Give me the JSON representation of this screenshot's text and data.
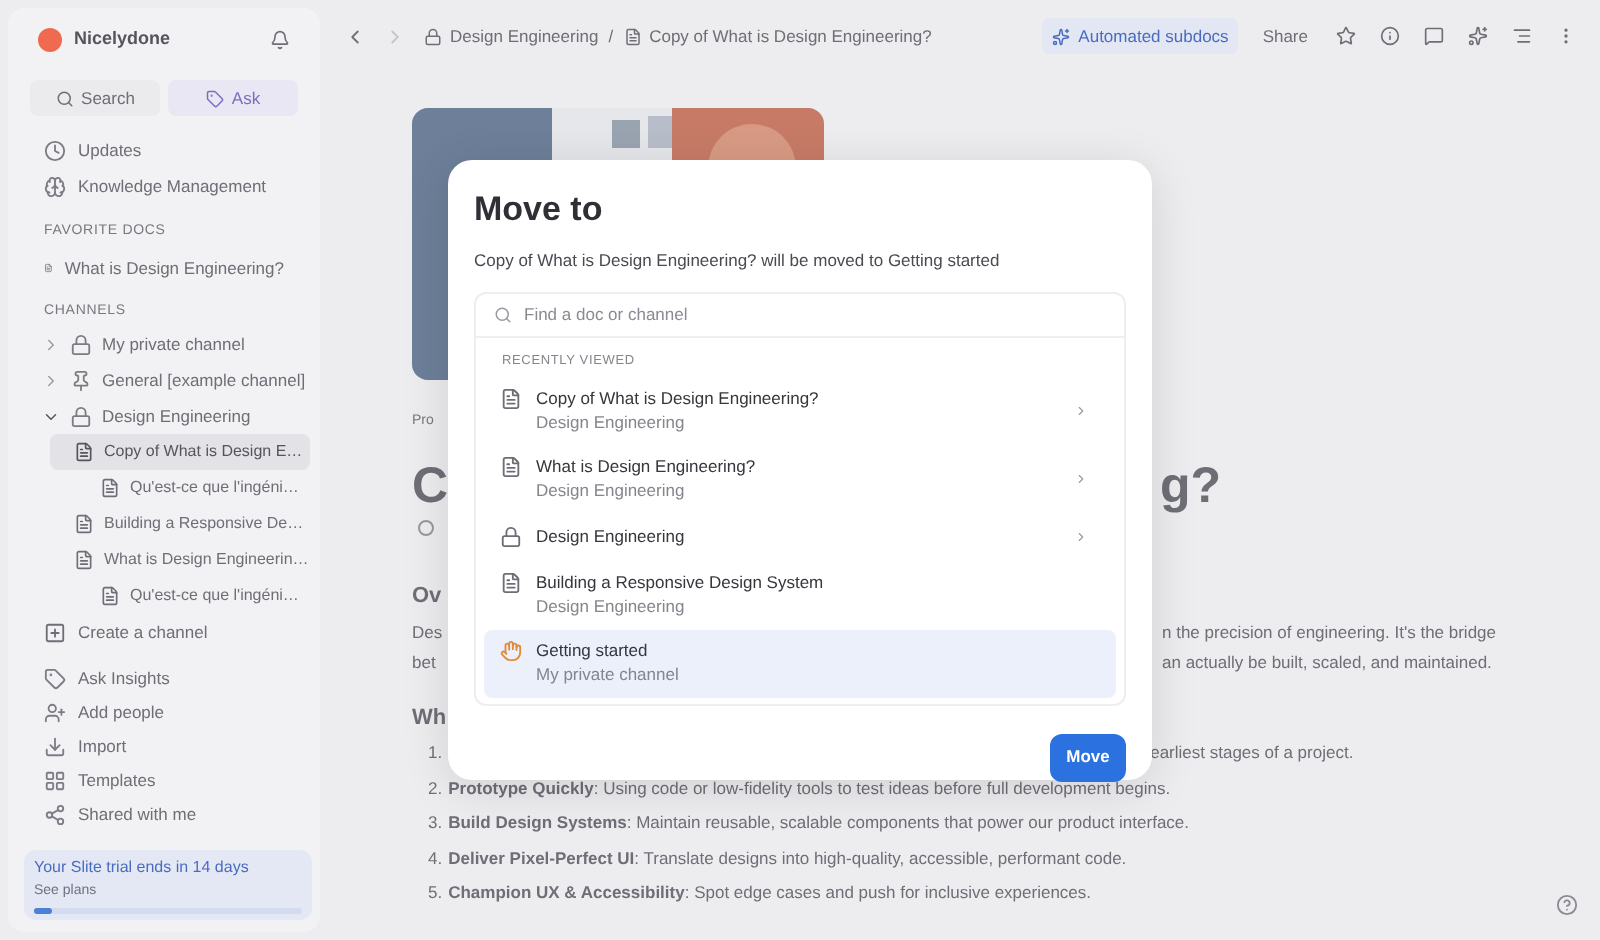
{
  "sidebar": {
    "workspace": "Nicelydone",
    "search": "Search",
    "ask": "Ask",
    "nav": [
      {
        "label": "Updates",
        "kind": "clock"
      },
      {
        "label": "Knowledge Management",
        "kind": "brain"
      }
    ],
    "favorites": {
      "heading": "FAVORITE DOCS",
      "items": [
        {
          "label": "What is Design Engineering?"
        }
      ]
    },
    "channels": {
      "heading": "CHANNELS",
      "items": [
        {
          "label": "My private channel",
          "kind": "lock",
          "expanded": false
        },
        {
          "label": "General [example channel]",
          "kind": "pin",
          "expanded": false
        },
        {
          "label": "Design Engineering",
          "kind": "lock",
          "expanded": true,
          "children": [
            {
              "label": "Copy of What is Design E…",
              "selected": true,
              "children": [
                {
                  "label": "Qu'est-ce que l'ingéni…",
                  "selected": false
                }
              ]
            },
            {
              "label": "Building a Responsive De…",
              "selected": false
            },
            {
              "label": "What is Design Engineerin…",
              "selected": false,
              "children": [
                {
                  "label": "Qu'est-ce que l'ingéni…",
                  "selected": false
                }
              ]
            }
          ]
        }
      ]
    },
    "create_channel": "Create a channel",
    "actions": [
      {
        "label": "Ask Insights",
        "kind": "sparkle"
      },
      {
        "label": "Add people",
        "kind": "person"
      },
      {
        "label": "Import",
        "kind": "import"
      },
      {
        "label": "Templates",
        "kind": "grid"
      },
      {
        "label": "Shared with me",
        "kind": "shared"
      }
    ],
    "trial": {
      "title": "Your Slite trial ends in 14 days",
      "link": "See plans",
      "level": 0.07
    }
  },
  "top_bar": {
    "breadcrumb": [
      {
        "label": "Design Engineering",
        "kind": "channel"
      },
      {
        "label": "Copy of What is Design Engineering?",
        "kind": "doc"
      }
    ],
    "separator": "/",
    "automated": "Automated subdocs",
    "share": "Share"
  },
  "document": {
    "label": "Pro",
    "title_start": "C",
    "title_end": "g?",
    "heading_1": "Ov",
    "paragraph": [
      {
        "left": "Des",
        "right": "n the precision of engineering. It's the bridge"
      },
      {
        "left": "bet",
        "right": "an actually be built, scaled, and maintained."
      }
    ],
    "heading_2": "Wh",
    "list": [
      {
        "number": "1.",
        "text": "earliest stages of a project."
      },
      {
        "number": "2.",
        "text": "**Prototype Quickly**: Using code or low-fidelity tools to test ideas before full development begins."
      },
      {
        "number": "3.",
        "text": "**Build Design Systems**: Maintain reusable, scalable components that power our product interface."
      },
      {
        "number": "4.",
        "text": "**Deliver Pixel-Perfect UI**: Translate designs into high-quality, accessible, performant code."
      },
      {
        "number": "5.",
        "text": "**Champion UX & Accessibility**: Spot edge cases and push for inclusive experiences."
      }
    ]
  },
  "dialog": {
    "title": "Move to",
    "description": "Copy of What is Design Engineering? will be moved to Getting started",
    "search": {
      "placeholder": "Find a doc or channel"
    },
    "section": "RECENTLY VIEWED",
    "items": [
      {
        "title": "Copy of What is Design Engineering?",
        "subtitle": "Design Engineering",
        "kind": "doc",
        "has_children": true,
        "selected": false
      },
      {
        "title": "What is Design Engineering?",
        "subtitle": "Design Engineering",
        "kind": "doc",
        "has_children": true,
        "selected": false
      },
      {
        "title": "Design Engineering",
        "kind": "channel",
        "has_children": true,
        "selected": false
      },
      {
        "title": "Building a Responsive Design System",
        "subtitle": "Design Engineering",
        "kind": "doc",
        "has_children": false,
        "selected": false
      },
      {
        "title": "Getting started",
        "subtitle": "My private channel",
        "kind": "welcome",
        "has_children": false,
        "selected": true
      }
    ],
    "button": "Move"
  }
}
